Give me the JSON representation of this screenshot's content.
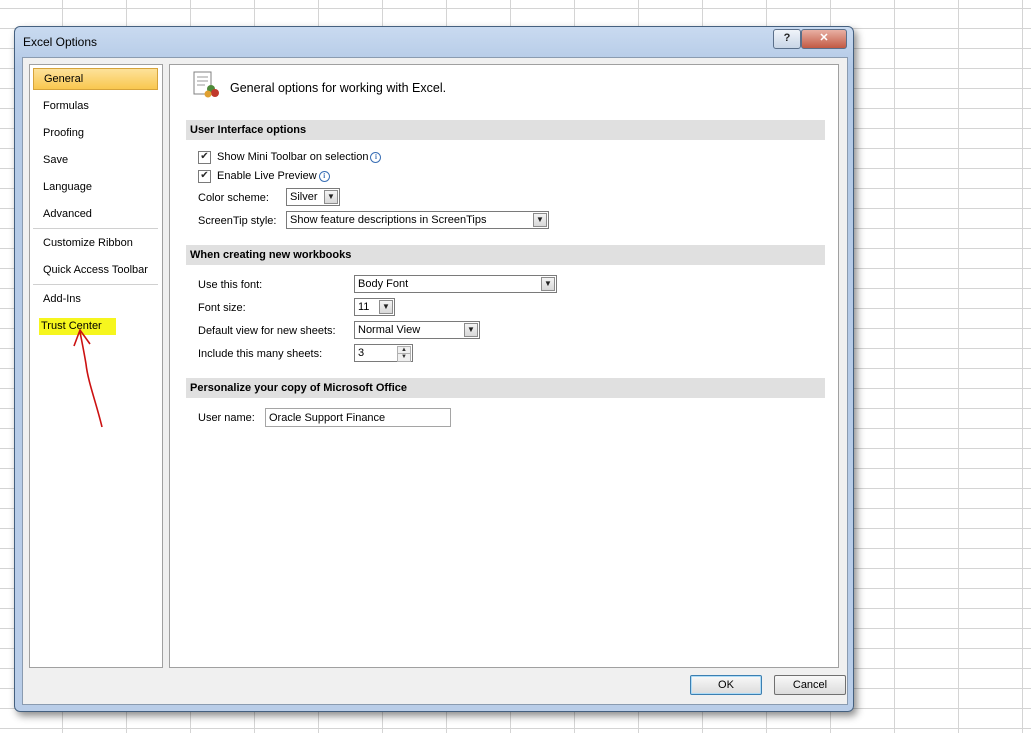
{
  "window": {
    "title": "Excel Options",
    "help_label": "?",
    "close_label": "✕"
  },
  "nav": {
    "items": [
      {
        "label": "General"
      },
      {
        "label": "Formulas"
      },
      {
        "label": "Proofing"
      },
      {
        "label": "Save"
      },
      {
        "label": "Language"
      },
      {
        "label": "Advanced"
      },
      {
        "label": "Customize Ribbon"
      },
      {
        "label": "Quick Access Toolbar"
      },
      {
        "label": "Add-Ins"
      },
      {
        "label": "Trust Center"
      }
    ],
    "selected": "General",
    "highlighted": "Trust Center",
    "annotation_color": "#cc1111"
  },
  "main": {
    "header": "General options for working with Excel.",
    "ui_section": {
      "title": "User Interface options",
      "mini_toolbar": {
        "label": "Show Mini Toolbar on selection",
        "checked": true
      },
      "live_preview": {
        "label": "Enable Live Preview",
        "checked": true
      },
      "color_scheme": {
        "label": "Color scheme:",
        "value": "Silver"
      },
      "screentip": {
        "label": "ScreenTip style:",
        "value": "Show feature descriptions in ScreenTips"
      }
    },
    "workbook_section": {
      "title": "When creating new workbooks",
      "font": {
        "label": "Use this font:",
        "value": "Body Font"
      },
      "font_size": {
        "label": "Font size:",
        "value": "11"
      },
      "default_view": {
        "label": "Default view for new sheets:",
        "value": "Normal View"
      },
      "sheets": {
        "label": "Include this many sheets:",
        "value": "3"
      }
    },
    "personalize_section": {
      "title": "Personalize your copy of Microsoft Office",
      "user_name": {
        "label": "User name:",
        "value": "Oracle Support Finance"
      }
    }
  },
  "footer": {
    "ok_label": "OK",
    "cancel_label": "Cancel"
  },
  "checkmark": "✔",
  "arrow_glyph": "▼",
  "info_glyph": "i"
}
